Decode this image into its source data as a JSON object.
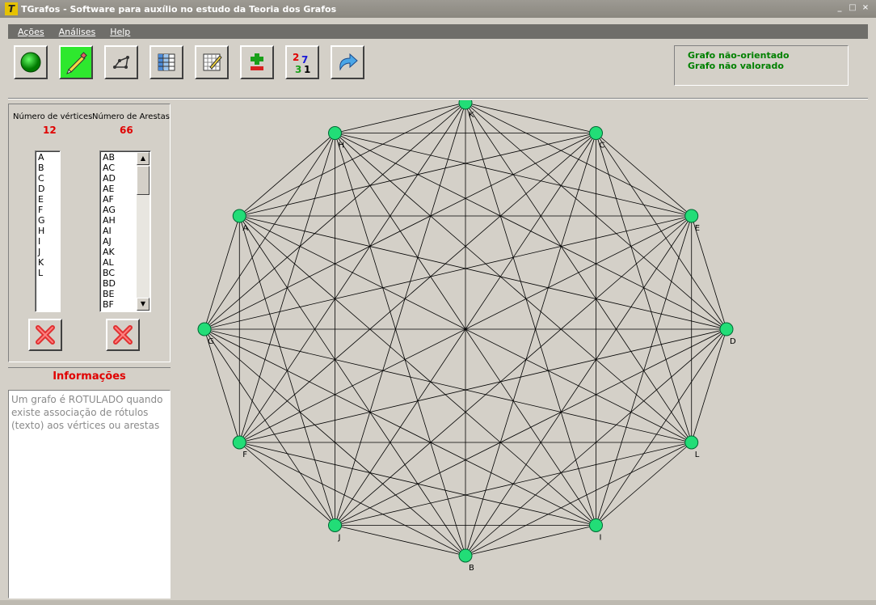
{
  "window": {
    "title": "TGrafos - Software para auxílio no estudo da Teoria dos Grafos",
    "controls": [
      "_",
      "□",
      "×"
    ]
  },
  "menu": {
    "items": [
      "Ações",
      "Análises",
      "Help"
    ]
  },
  "toolbar": {
    "buttons": [
      {
        "name": "vertex-tool",
        "icon": "green-circle-icon"
      },
      {
        "name": "edit-tool",
        "icon": "pencil-icon"
      },
      {
        "name": "graph-tool",
        "icon": "graph-icon"
      },
      {
        "name": "matrix-tool",
        "icon": "table-icon"
      },
      {
        "name": "edit-matrix-tool",
        "icon": "table-pencil-icon"
      },
      {
        "name": "plus-minus-tool",
        "icon": "plus-minus-icon"
      },
      {
        "name": "numbers-tool",
        "icon": "numbers-icon"
      },
      {
        "name": "redo-tool",
        "icon": "arrow-icon"
      }
    ],
    "numbers_icon": [
      "2",
      "7",
      "3",
      "1"
    ]
  },
  "status": {
    "line1": "Grafo não-orientado",
    "line2": "Grafo não valorado"
  },
  "panel": {
    "vertices_label": "Número de vértices",
    "vertices_count": "12",
    "edges_label": "Número de Arestas",
    "edges_count": "66",
    "vertices": [
      "A",
      "B",
      "C",
      "D",
      "E",
      "F",
      "G",
      "H",
      "I",
      "J",
      "K",
      "L"
    ],
    "edges": [
      "AB",
      "AC",
      "AD",
      "AE",
      "AF",
      "AG",
      "AH",
      "AI",
      "AJ",
      "AK",
      "AL",
      "BC",
      "BD",
      "BE",
      "BF"
    ],
    "info_title": "Informações",
    "info_text": "Um grafo é ROTULADO quando existe associação de rótulos (texto) aos vértices ou arestas"
  },
  "graph": {
    "vertices": [
      {
        "label": "K"
      },
      {
        "label": "C"
      },
      {
        "label": "E"
      },
      {
        "label": "D"
      },
      {
        "label": "L"
      },
      {
        "label": "I"
      },
      {
        "label": "B"
      },
      {
        "label": "J"
      },
      {
        "label": "F"
      },
      {
        "label": "G"
      },
      {
        "label": "A"
      },
      {
        "label": "H"
      }
    ],
    "vertex_color": "#22dd77",
    "complete": true
  },
  "colors": {
    "accent_red": "#e00000",
    "status_green": "#008000"
  }
}
